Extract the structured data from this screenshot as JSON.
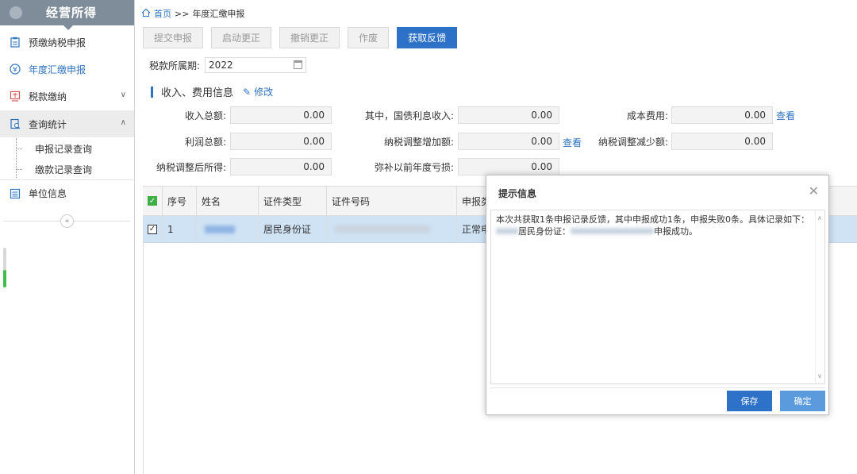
{
  "sidebar": {
    "title": "经营所得",
    "items": [
      {
        "label": "预缴纳税申报",
        "icon": "clipboard-icon"
      },
      {
        "label": "年度汇缴申报",
        "icon": "yen-circle-icon"
      },
      {
        "label": "税款缴纳",
        "icon": "tax-payment-icon"
      },
      {
        "label": "查询统计",
        "icon": "query-stats-icon"
      },
      {
        "label": "单位信息",
        "icon": "list-icon"
      }
    ],
    "sub_items": [
      "申报记录查询",
      "缴款记录查询"
    ]
  },
  "breadcrumb": {
    "home": "首页",
    "separator": ">>",
    "current": "年度汇缴申报"
  },
  "toolbar": {
    "submit": "提交申报",
    "start_correction": "启动更正",
    "cancel_correction": "撤销更正",
    "void": "作废",
    "get_feedback": "获取反馈"
  },
  "period": {
    "label": "税款所属期:",
    "value": "2022"
  },
  "income_section": {
    "title": "收入、费用信息",
    "edit": "修改",
    "view": "查看",
    "fields": {
      "total_income": {
        "label": "收入总额:",
        "value": "0.00"
      },
      "treasury_interest": {
        "label": "其中，国债利息收入:",
        "value": "0.00"
      },
      "cost_expense": {
        "label": "成本费用:",
        "value": "0.00"
      },
      "total_profit": {
        "label": "利润总额:",
        "value": "0.00"
      },
      "tax_adj_increase": {
        "label": "纳税调整增加额:",
        "value": "0.00"
      },
      "tax_adj_decrease": {
        "label": "纳税调整减少额:",
        "value": "0.00"
      },
      "adjusted_income": {
        "label": "纳税调整后所得:",
        "value": "0.00"
      },
      "prior_loss": {
        "label": "弥补以前年度亏损:",
        "value": "0.00"
      }
    }
  },
  "table": {
    "headers": [
      "序号",
      "姓名",
      "证件类型",
      "证件号码",
      "申报类"
    ],
    "rows": [
      {
        "index": "1",
        "id_type": "居民身份证",
        "status": "正常申"
      }
    ]
  },
  "dialog": {
    "title": "提示信息",
    "message_line1": "本次共获取1条申报记录反馈，其中申报成功1条，申报失败0条。具体记录如下：",
    "message_line2_a": "居民身份证：",
    "message_line2_b": "申报成功。",
    "save": "保存",
    "ok": "确定"
  },
  "colors": {
    "accent": "#2d71c8",
    "sidebar_header": "#7f8c99",
    "selected_row": "#cfe3f5"
  }
}
